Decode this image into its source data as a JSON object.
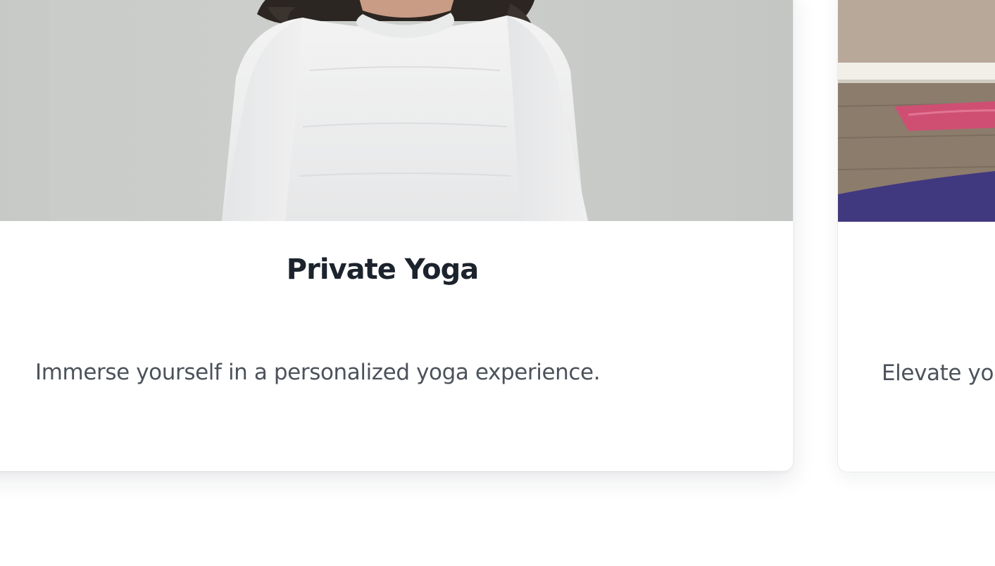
{
  "services": [
    {
      "title": "Private Yoga",
      "description": "Immerse yourself in a personalized yoga experience.",
      "image_alt": "Woman in white sweater meditating"
    },
    {
      "title": "",
      "description": "Elevate your practice with personalized yoga sessions.",
      "image_alt": "Yoga mats on a wooden studio floor"
    }
  ],
  "colors": {
    "title": "#1c232d",
    "description": "#4c525b",
    "card_background": "#ffffff"
  }
}
